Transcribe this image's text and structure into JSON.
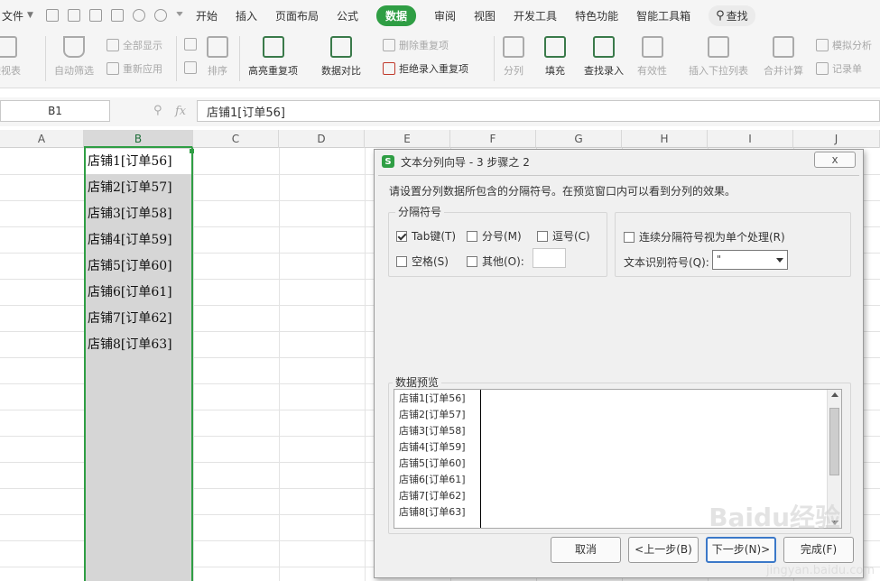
{
  "menubar": {
    "file": "文件",
    "tabs": [
      "开始",
      "插入",
      "页面布局",
      "公式",
      "数据",
      "审阅",
      "视图",
      "开发工具",
      "特色功能",
      "智能工具箱"
    ],
    "active_tab": "数据",
    "search": "查找"
  },
  "ribbon": {
    "pivot": "透视表",
    "autofilter": "自动筛选",
    "show_all": "全部显示",
    "reapply": "重新应用",
    "sort": "排序",
    "highlight_dup": "高亮重复项",
    "data_compare": "数据对比",
    "remove_dup": "删除重复项",
    "reject_dup": "拒绝录入重复项",
    "split": "分列",
    "fill": "填充",
    "lookup": "查找录入",
    "validity": "有效性",
    "dropdown": "插入下拉列表",
    "merge_calc": "合并计算",
    "simulate": "模拟分析",
    "record": "记录单"
  },
  "formula_bar": {
    "name_box": "B1",
    "fx": "fx",
    "content": "店铺1[订单56]"
  },
  "columns": [
    "A",
    "B",
    "C",
    "D",
    "E",
    "F",
    "G",
    "H",
    "I",
    "J"
  ],
  "selected_column": "B",
  "cells_b": [
    "店铺1[订单56]",
    "店铺2[订单57]",
    "店铺3[订单58]",
    "店铺4[订单59]",
    "店铺5[订单60]",
    "店铺6[订单61]",
    "店铺7[订单62]",
    "店铺8[订单63]"
  ],
  "dialog": {
    "app_icon": "S",
    "title": "文本分列向导 - 3 步骤之 2",
    "close": "x",
    "description": "请设置分列数据所包含的分隔符号。在预览窗口内可以看到分列的效果。",
    "delimiters_group": "分隔符号",
    "tab": "Tab键(T)",
    "semicolon": "分号(M)",
    "comma": "逗号(C)",
    "space": "空格(S)",
    "other": "其他(O):",
    "consecutive": "连续分隔符号视为单个处理(R)",
    "text_qualifier_label": "文本识别符号(Q):",
    "text_qualifier_value": "\"",
    "preview_label": "数据预览",
    "preview_rows": [
      "店铺1[订单56]",
      "店铺2[订单57]",
      "店铺3[订单58]",
      "店铺4[订单59]",
      "店铺5[订单60]",
      "店铺6[订单61]",
      "店铺7[订单62]",
      "店铺8[订单63]"
    ],
    "buttons": {
      "cancel": "取消",
      "back": "<上一步(B)",
      "next": "下一步(N)>",
      "finish": "完成(F)"
    },
    "checked": {
      "tab": true,
      "semicolon": false,
      "comma": false,
      "space": false,
      "other": false,
      "consecutive": false
    }
  },
  "watermark": {
    "brand": "Baidu经验",
    "url": "jingyan.baidu.com"
  },
  "colors": {
    "accent": "#2f9e44",
    "selected_column": "#d6d6d6",
    "default_button": "#3b78c8"
  }
}
